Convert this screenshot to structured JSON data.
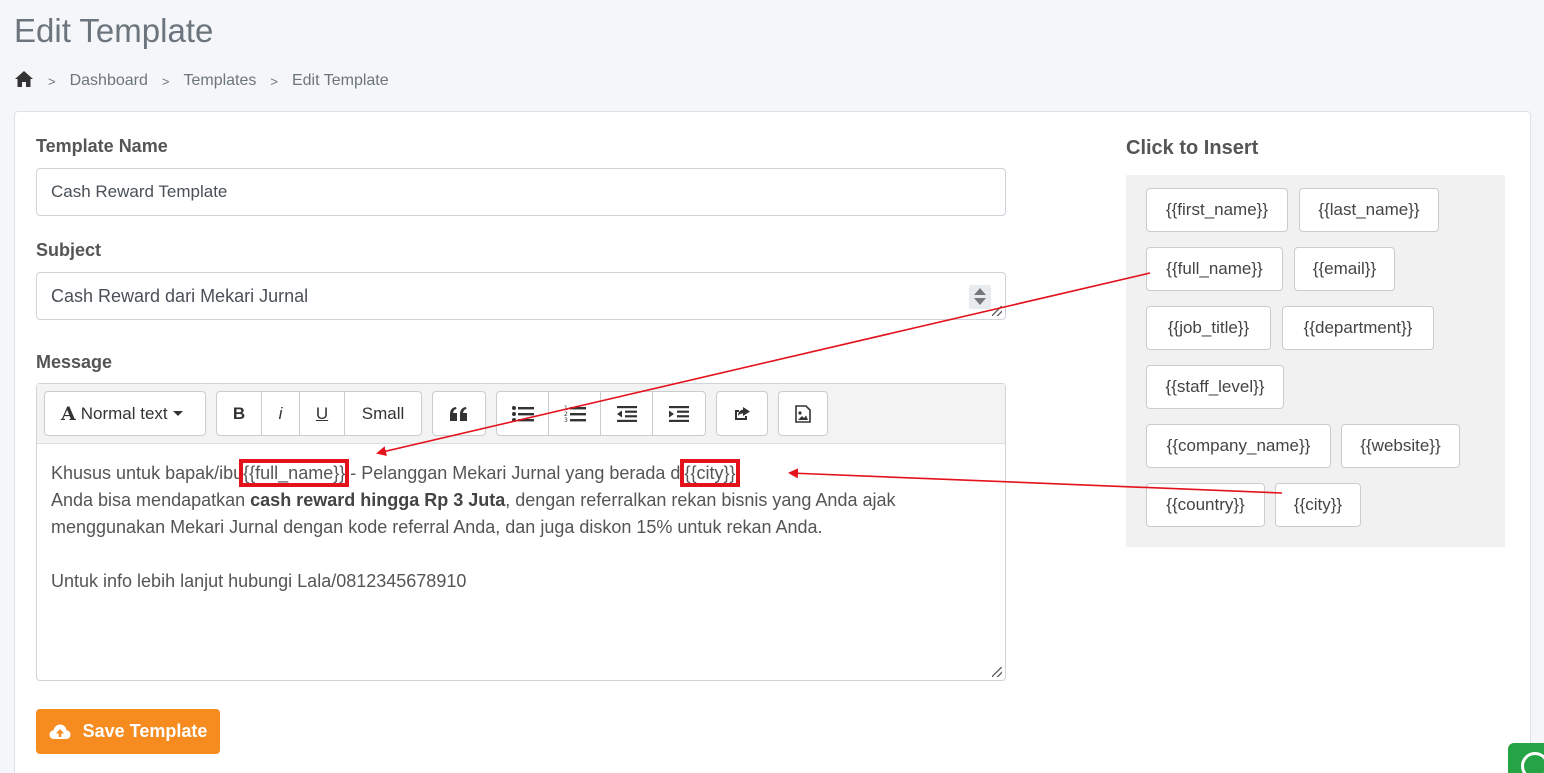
{
  "page": {
    "title": "Edit Template"
  },
  "breadcrumb": {
    "home_icon": "home-icon",
    "items": [
      "Dashboard",
      "Templates",
      "Edit Template"
    ]
  },
  "form": {
    "template_name_label": "Template Name",
    "template_name_value": "Cash Reward Template",
    "subject_label": "Subject",
    "subject_value": "Cash Reward dari Mekari Jurnal",
    "message_label": "Message"
  },
  "toolbar": {
    "format_label": "Normal text",
    "bold": "B",
    "italic": "i",
    "underline": "U",
    "small": "Small"
  },
  "message": {
    "line1_a": "Khusus untuk bapak/ibu",
    "line1_tag1": "{{full_name}}",
    "line1_b": " - Pelanggan Mekari Jurnal yang berada di",
    "line1_tag2": "{{city}}",
    "line2_a": "Anda bisa mendapatkan ",
    "line2_bold": "cash reward hingga Rp 3 Juta",
    "line2_b": ", dengan referralkan rekan bisnis yang Anda ajak",
    "line3": "menggunakan Mekari Jurnal dengan kode referral Anda, dan juga diskon 15% untuk rekan Anda.",
    "line5": "Untuk info lebih lanjut hubungi Lala/0812345678910"
  },
  "save_button": "Save Template",
  "insert_panel": {
    "title": "Click to Insert",
    "tags": [
      "{{first_name}}",
      "{{last_name}}",
      "{{full_name}}",
      "{{email}}",
      "{{job_title}}",
      "{{department}}",
      "{{staff_level}}",
      "{{company_name}}",
      "{{website}}",
      "{{country}}",
      "{{city}}"
    ]
  },
  "colors": {
    "accent": "#f68b1f",
    "highlight": "#e3121b",
    "whatsapp": "#25a445"
  }
}
